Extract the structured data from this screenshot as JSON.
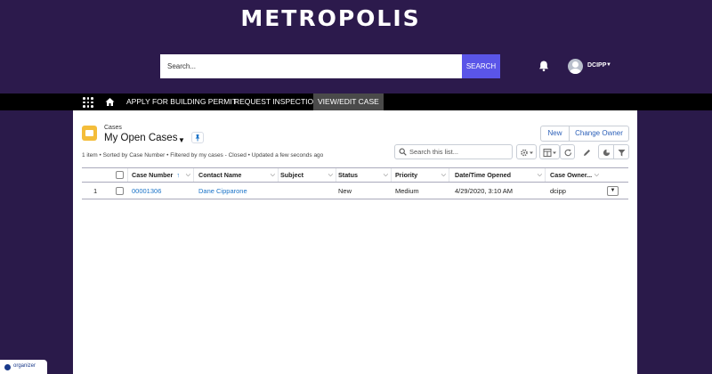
{
  "brand": {
    "title": "METROPOLIS"
  },
  "header": {
    "search_placeholder": "Search...",
    "search_button": "SEARCH",
    "user_name": "DCIPP"
  },
  "nav": {
    "items": [
      {
        "label": "APPLY FOR BUILDING PERMIT",
        "active": false
      },
      {
        "label": "REQUEST INSPECTION",
        "active": false
      },
      {
        "label": "VIEW/EDIT CASE",
        "active": true
      }
    ]
  },
  "list_view": {
    "object_label": "Cases",
    "title": "My Open Cases",
    "new_button": "New",
    "change_owner_button": "Change Owner",
    "meta": "1 item • Sorted by Case Number • Filtered by my cases - Closed • Updated a few seconds ago",
    "search_placeholder": "Search this list...",
    "columns": [
      "Case Number",
      "Contact Name",
      "Subject",
      "Status",
      "Priority",
      "Date/Time Opened",
      "Case Owner..."
    ],
    "sort_indicator": "↑",
    "rows": [
      {
        "index": "1",
        "case_number": "00001306",
        "contact_name": "Dane Cipparone",
        "subject": "",
        "status": "New",
        "priority": "Medium",
        "date_opened": "4/29/2020, 3:10 AM",
        "case_owner": "dcipp"
      }
    ]
  },
  "footer": {
    "organizer_label": "organizer"
  },
  "colors": {
    "header_bg": "#2c1a4c",
    "search_button_bg": "#5a55e8",
    "nav_bg": "#000000",
    "nav_active_bg": "#4a4a4a",
    "link": "#1a73c8",
    "object_icon": "#f4bd3a"
  },
  "icons": [
    "bell-icon",
    "avatar",
    "app-launcher-icon",
    "home-icon",
    "folder-icon",
    "pin-icon",
    "search-icon",
    "gear-icon",
    "table-icon",
    "refresh-icon",
    "pencil-icon",
    "chart-icon",
    "filter-icon",
    "chevron-down-icon"
  ]
}
